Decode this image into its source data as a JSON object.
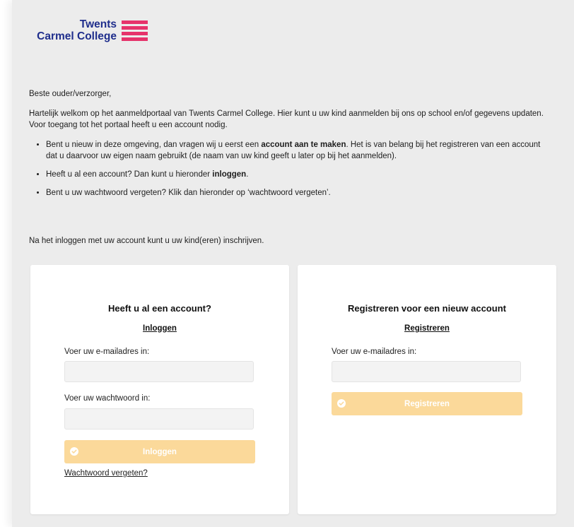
{
  "brand": {
    "line1": "Twents",
    "line2": "Carmel College",
    "color": "#1f2e8c",
    "accent": "#e6336b"
  },
  "intro": {
    "greeting": "Beste ouder/verzorger,",
    "paragraph": "Hartelijk welkom op het aanmeldportaal van Twents Carmel College. Hier kunt u uw kind aanmelden bij ons op school en/of gegevens updaten. Voor toegang tot het portaal heeft u een account nodig.",
    "bullet1_before": "Bent u nieuw in deze omgeving, dan vragen wij u eerst een ",
    "bullet1_bold": "account aan te maken",
    "bullet1_after": ". Het is van belang bij het registreren van een account dat u daarvoor uw eigen naam gebruikt (de naam van uw kind geeft u later op bij het aanmelden).",
    "bullet2_before": "Heeft u al een account? Dan kunt u hieronder ",
    "bullet2_bold": "inloggen",
    "bullet2_after": ".",
    "bullet3": "Bent u uw wachtwoord vergeten? Klik dan hieronder op ‘wachtwoord vergeten’.",
    "after": "Na het inloggen met uw account kunt u uw kind(eren) inschrijven."
  },
  "login": {
    "title": "Heeft u al een account?",
    "link": "Inloggen",
    "email_label": "Voer uw e-mailadres in:",
    "email_value": "",
    "password_label": "Voer uw wachtwoord in:",
    "password_value": "",
    "button": "Inloggen",
    "forgot": "Wachtwoord vergeten?"
  },
  "register": {
    "title": "Registreren voor een nieuw account",
    "link": "Registreren",
    "email_label": "Voer uw e-mailadres in:",
    "email_value": "",
    "button": "Registreren"
  },
  "colors": {
    "button_disabled": "#fbd99a",
    "background": "#ececec"
  },
  "icons": {
    "button_icon": "check-circle-icon"
  }
}
